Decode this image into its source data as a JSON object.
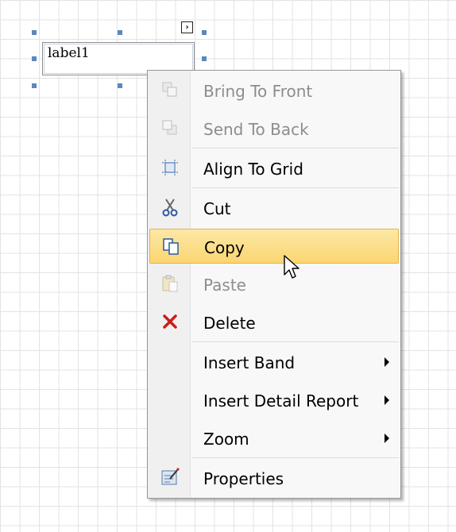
{
  "label_control": {
    "text": "label1",
    "smart_tag_symbol": "›"
  },
  "menu": {
    "items": [
      {
        "label": "Bring To Front",
        "icon": "bring-to-front-icon",
        "disabled": true
      },
      {
        "label": "Send To Back",
        "icon": "send-to-back-icon",
        "disabled": true
      },
      {
        "label": "Align To Grid",
        "icon": "align-to-grid-icon",
        "disabled": false
      },
      {
        "label": "Cut",
        "icon": "cut-icon",
        "disabled": false
      },
      {
        "label": "Copy",
        "icon": "copy-icon",
        "disabled": false,
        "highlighted": true
      },
      {
        "label": "Paste",
        "icon": "paste-icon",
        "disabled": true
      },
      {
        "label": "Delete",
        "icon": "delete-icon",
        "disabled": false
      },
      {
        "label": "Insert Band",
        "has_submenu": true
      },
      {
        "label": "Insert Detail Report",
        "has_submenu": true
      },
      {
        "label": "Zoom",
        "has_submenu": true
      },
      {
        "label": "Properties",
        "icon": "properties-icon",
        "disabled": false
      }
    ]
  },
  "colors": {
    "highlight": "#fbd571",
    "delete_red": "#cc1a1a",
    "handle": "#5f86bd"
  }
}
